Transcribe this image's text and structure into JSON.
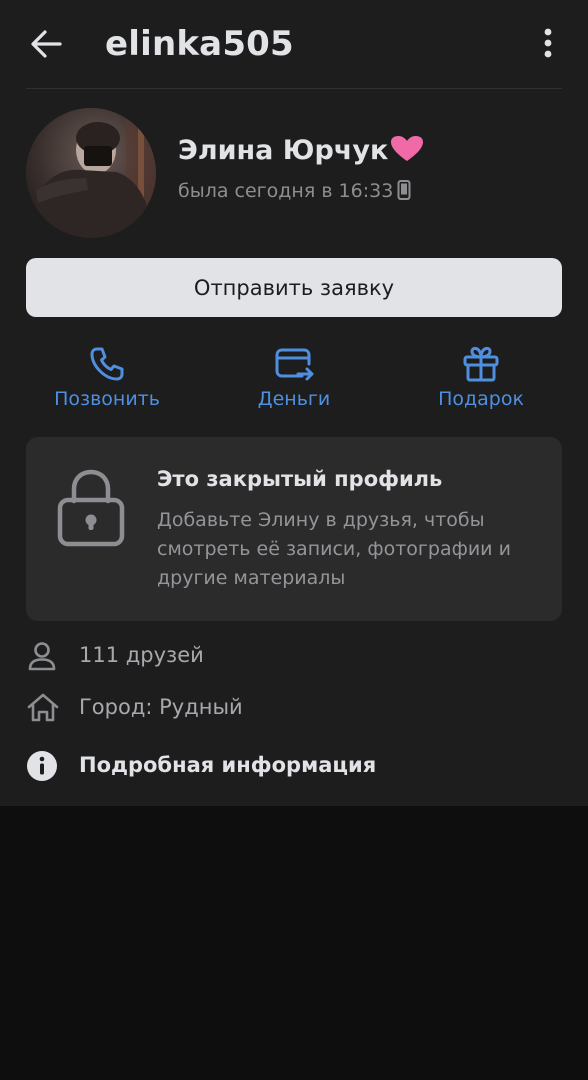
{
  "header": {
    "title": "elinka505"
  },
  "profile": {
    "name": "Элина Юрчук",
    "last_seen": "была сегодня в 16:33"
  },
  "actions": {
    "request_label": "Отправить заявку",
    "call_label": "Позвонить",
    "money_label": "Деньги",
    "gift_label": "Подарок"
  },
  "closed_profile": {
    "title": "Это закрытый профиль",
    "description": "Добавьте Элину в друзья, чтобы смотреть её записи, фотографии и другие материалы"
  },
  "info": {
    "friends": "111 друзей",
    "city": "Город: Рудный",
    "details": "Подробная информация"
  },
  "colors": {
    "accent": "#4f8fe0",
    "background": "#1d1d1e",
    "card": "#2b2b2c",
    "heart": "#f06aa8"
  },
  "icons": {
    "back": "arrow-left-icon",
    "more": "kebab-menu-icon",
    "heart": "pink-heart-icon",
    "device": "mobile-phone-icon",
    "call": "phone-icon",
    "money": "card-transfer-icon",
    "gift": "gift-icon",
    "lock": "lock-icon",
    "friends": "user-icon",
    "city": "home-icon",
    "details": "info-icon"
  }
}
